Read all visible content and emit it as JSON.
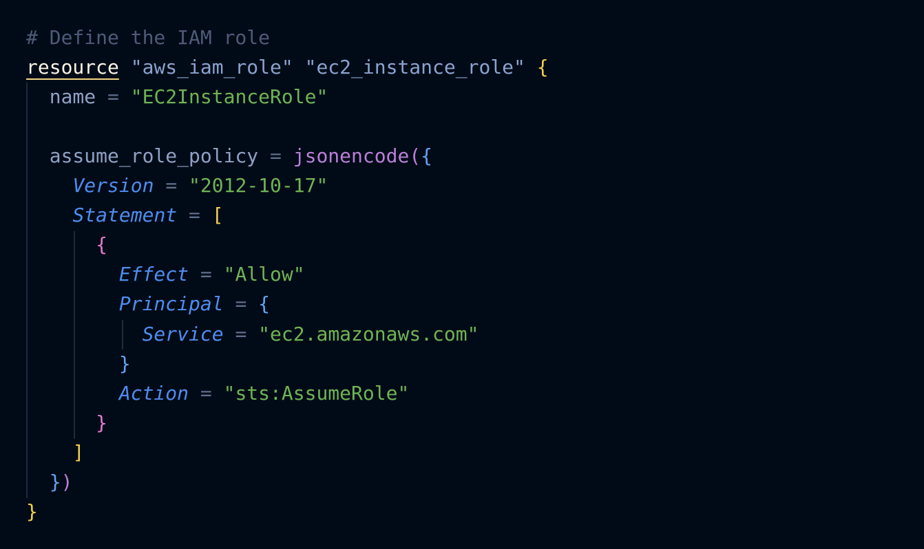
{
  "code": {
    "comment": "# Define the IAM role",
    "resource_keyword": "resource",
    "resource_type": "\"aws_iam_role\"",
    "resource_name": "\"ec2_instance_role\"",
    "open_brace": "{",
    "name_attr": "name",
    "equals": "=",
    "name_value": "\"EC2InstanceRole\"",
    "policy_attr": "assume_role_policy",
    "function": "jsonencode",
    "paren_open": "(",
    "version_key": "Version",
    "version_value": "\"2012-10-17\"",
    "statement_key": "Statement",
    "bracket_open": "[",
    "effect_key": "Effect",
    "effect_value": "\"Allow\"",
    "principal_key": "Principal",
    "service_key": "Service",
    "service_value": "\"ec2.amazonaws.com\"",
    "close_brace": "}",
    "action_key": "Action",
    "action_value": "\"sts:AssumeRole\"",
    "bracket_close": "]",
    "paren_close": ")"
  }
}
